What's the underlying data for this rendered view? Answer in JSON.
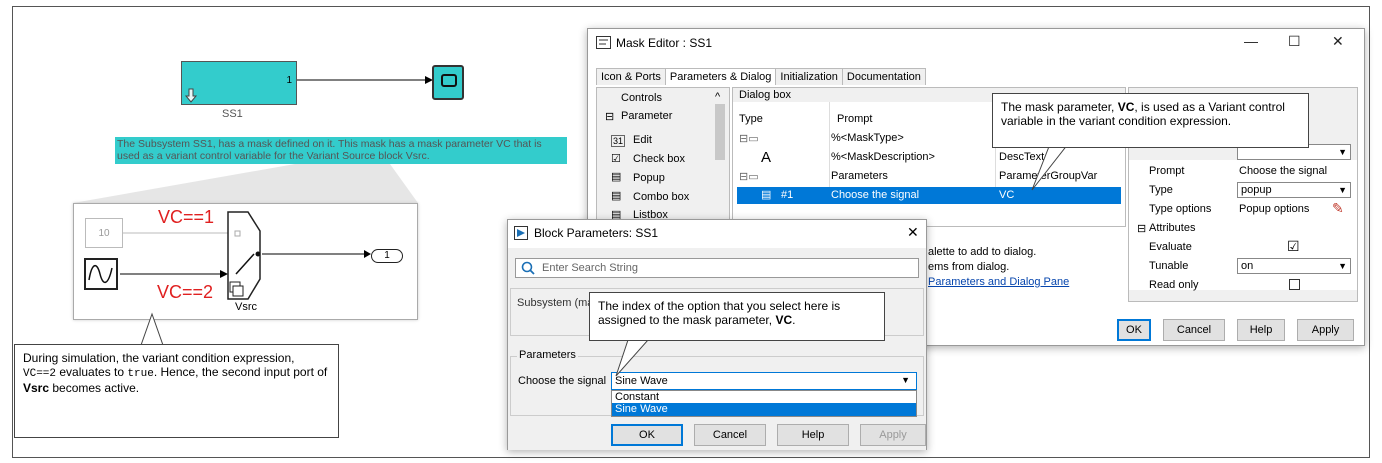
{
  "diagram": {
    "subsystem_port": "1",
    "subsystem_label": "SS1",
    "annotation": "The Subsystem SS1, has a mask defined on it. This mask has a mask parameter VC that is used as a variant control variable for the Variant Source block Vsrc.",
    "constant_value": "10",
    "vc1_label": "VC==1",
    "vc2_label": "VC==2",
    "vsrc_label": "Vsrc",
    "outport_label": "1"
  },
  "callout_simulation": {
    "part1": "During simulation, the variant condition expression, ",
    "code1": "VC==2",
    "part2": " evaluates to ",
    "code2": "true",
    "part3": ". Hence, the second input port of ",
    "bold": "Vsrc",
    "part4": " becomes active."
  },
  "callout_mask": {
    "part1": "The mask parameter, ",
    "bold": "VC",
    "part2": ", is used as a Variant control variable in the variant condition expression."
  },
  "callout_index": {
    "part1": "The index of the option that you select here is assigned to the mask parameter, ",
    "bold": "VC",
    "part2": "."
  },
  "mask_editor": {
    "title": "Mask Editor : SS1",
    "minimize": "—",
    "maximize": "☐",
    "close": "✕",
    "tabs": [
      "Icon & Ports",
      "Parameters & Dialog",
      "Initialization",
      "Documentation"
    ],
    "controls_header": "Controls",
    "controls": [
      "Parameter",
      "Edit",
      "Check box",
      "Popup",
      "Combo box",
      "Listbox"
    ],
    "dialog_box_header": "Dialog box",
    "col_type": "Type",
    "col_prompt": "Prompt",
    "rows": [
      {
        "type": "",
        "prompt": "%<MaskType>",
        "name": ""
      },
      {
        "type": "A",
        "prompt": "%<MaskDescription>",
        "name": "DescText"
      },
      {
        "type": "",
        "prompt": "Parameters",
        "name": "ParameterGroupVar"
      },
      {
        "type": "#1",
        "prompt": "Choose the signal",
        "name": "VC"
      }
    ],
    "hint_line1": "alette to add to dialog.",
    "hint_line2": "ems from dialog.",
    "hint_link": "Parameters and Dialog Pane",
    "props": [
      {
        "label": "Prompt",
        "value": "Choose the signal"
      },
      {
        "label": "Type",
        "value": "popup"
      },
      {
        "label": "Type options",
        "value": "Popup options"
      }
    ],
    "attributes_header": "Attributes",
    "attrs": [
      {
        "label": "Evaluate",
        "value": "☑"
      },
      {
        "label": "Tunable",
        "value": "on"
      },
      {
        "label": "Read only",
        "value": ""
      }
    ],
    "btn_ok": "OK",
    "btn_cancel": "Cancel",
    "btn_help": "Help",
    "btn_apply": "Apply"
  },
  "block_params": {
    "title": "Block Parameters: SS1",
    "close": "✕",
    "search_placeholder": "Enter Search String",
    "subsystem_label": "Subsystem (ma",
    "parameters_group": "Parameters",
    "choose_label": "Choose the signal",
    "selected_value": "Sine Wave",
    "options": [
      "Constant",
      "Sine Wave"
    ],
    "btn_ok": "OK",
    "btn_cancel": "Cancel",
    "btn_help": "Help",
    "btn_apply": "Apply"
  },
  "colors": {
    "block_cyan": "#33cccc",
    "selection_blue": "#0078d7",
    "variant_red": "#e02020"
  }
}
